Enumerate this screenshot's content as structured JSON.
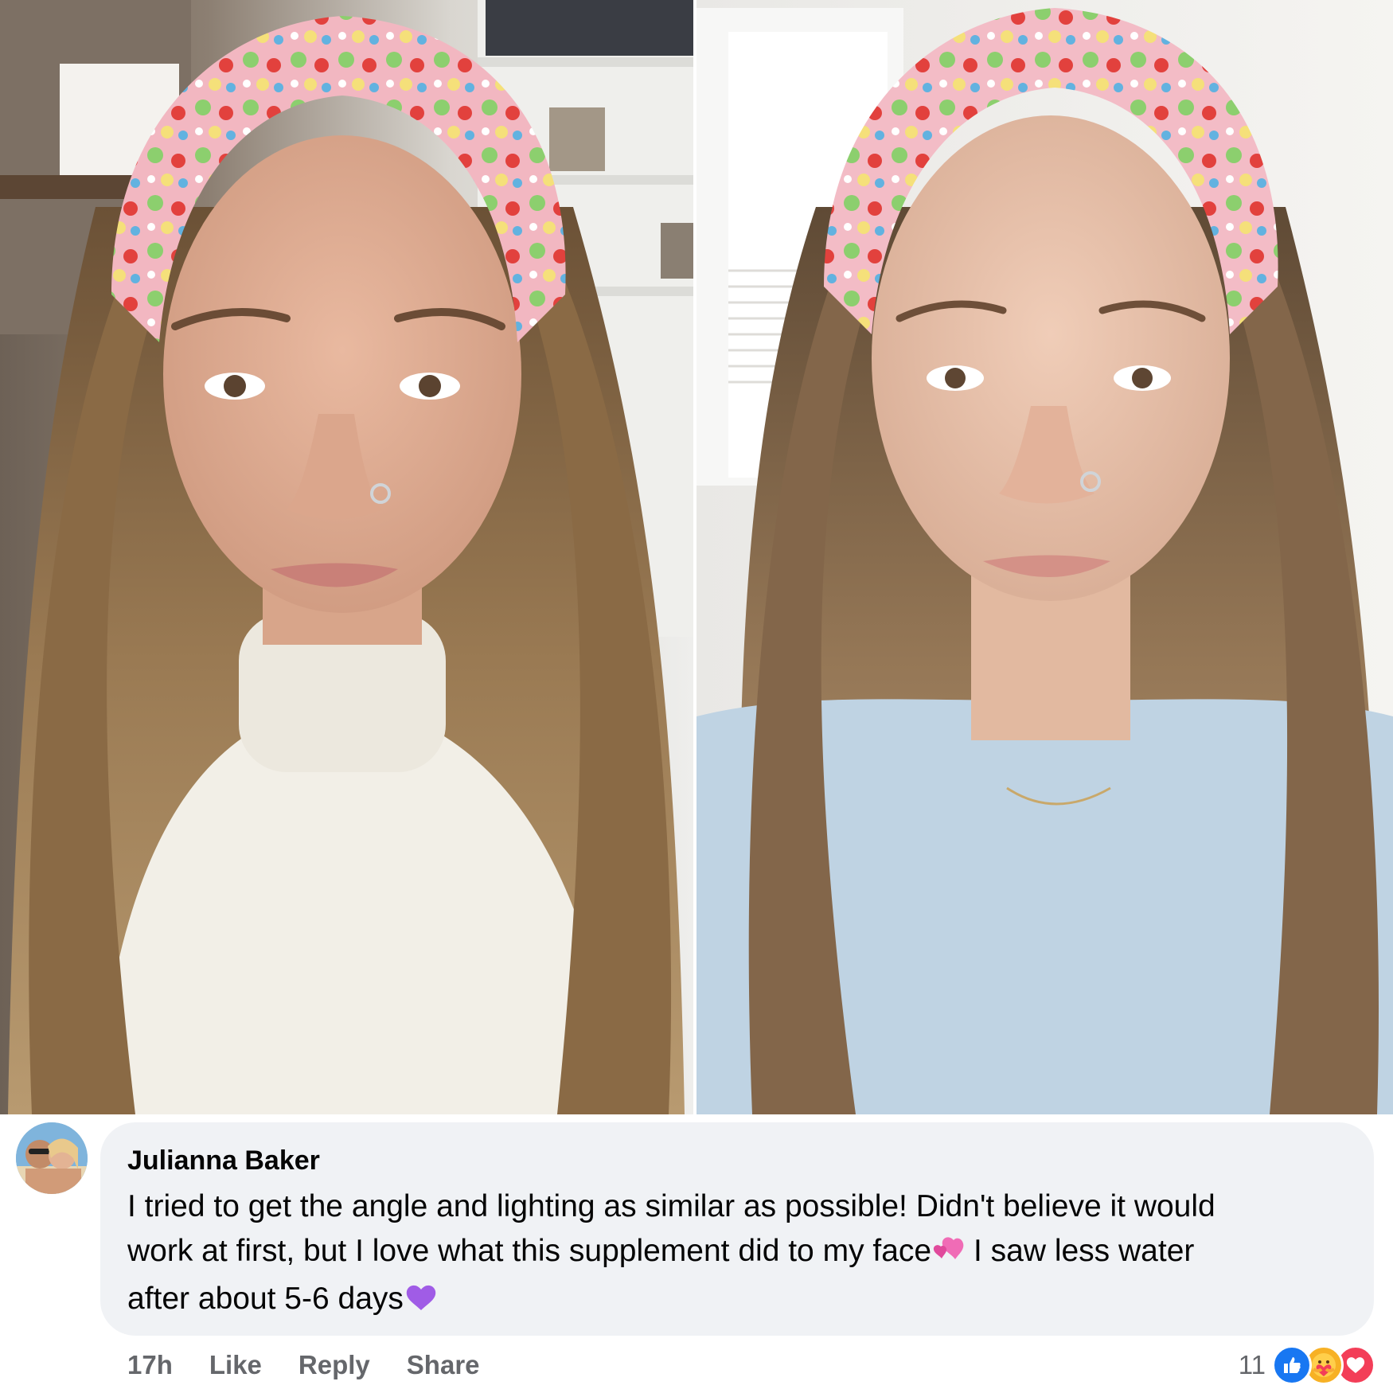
{
  "photos": {
    "before_alt": "",
    "after_alt": ""
  },
  "comment": {
    "author": "Julianna Baker",
    "text_line1": "I tried to get the angle and lighting as similar as possible! Didn't believe it would",
    "text_line2_a": "work at first, but I love what this supplement did to my face",
    "text_line2_b": " I saw less water",
    "text_line3": "after about 5-6 days",
    "emoji_1": "revolving-hearts-icon",
    "emoji_2": "purple-heart-icon"
  },
  "actions": {
    "time": "17h",
    "like_label": "Like",
    "reply_label": "Reply",
    "share_label": "Share"
  },
  "reactions": {
    "count": "11",
    "types": [
      "like-icon",
      "care-icon",
      "love-icon"
    ]
  },
  "colors": {
    "bubble": "#f0f2f5",
    "meta_text": "#65676b",
    "like_blue": "#1877f2",
    "care_yellow": "#f7b125",
    "love_red": "#f33e58"
  }
}
